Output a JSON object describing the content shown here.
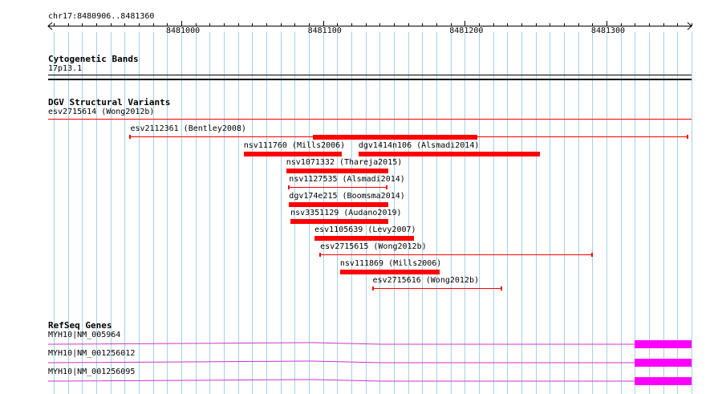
{
  "ruler": {
    "range_label": "chr17:8480906..8481360",
    "ticks": [
      8481000,
      8481100,
      8481200,
      8481300
    ]
  },
  "tracks": {
    "cytoband": {
      "title": "Cytogenetic Bands",
      "band_label": "17p13.1"
    },
    "dgv": {
      "title": "DGV Structural Variants",
      "top_label": "esv2715614 (Wong2012b)",
      "features": [
        {
          "label": "esv2112361 (Bentley2008)",
          "start": 8480964,
          "end": 8481357,
          "style": "line"
        },
        {
          "label": "",
          "start": 8481093,
          "end": 8481209,
          "style": "bar"
        },
        {
          "label": "nsv111760 (Mills2006)",
          "start": 8481044,
          "end": 8481113,
          "style": "bar"
        },
        {
          "label": "dgv1414n106 (Alsmadi2014)",
          "start": 8481125,
          "end": 8481253,
          "style": "bar"
        },
        {
          "label": "nsv1071332 (Thareja2015)",
          "start": 8481074,
          "end": 8481146,
          "style": "bar"
        },
        {
          "label": "nsv1127535 (Alsmadi2014)",
          "start": 8481076,
          "end": 8481145,
          "style": "line"
        },
        {
          "label": "dgv174e215 (Boomsma2014)",
          "start": 8481076,
          "end": 8481146,
          "style": "bar"
        },
        {
          "label": "nsv3351129 (Audano2019)",
          "start": 8481077,
          "end": 8481146,
          "style": "bar"
        },
        {
          "label": "esv1105639 (Levy2007)",
          "start": 8481094,
          "end": 8481164,
          "style": "bar"
        },
        {
          "label": "esv2715615 (Wong2012b)",
          "start": 8481098,
          "end": 8481290,
          "style": "line"
        },
        {
          "label": "nsv111869 (Mills2006)",
          "start": 8481112,
          "end": 8481182,
          "style": "bar"
        },
        {
          "label": "esv2715616 (Wong2012b)",
          "start": 8481135,
          "end": 8481226,
          "style": "line"
        }
      ]
    },
    "refseq": {
      "title": "RefSeq Genes",
      "genes": [
        {
          "label": "MYH10|NM_005964"
        },
        {
          "label": "MYH10|NM_001256012"
        },
        {
          "label": "MYH10|NM_001256095"
        }
      ]
    }
  },
  "colors": {
    "grid": "#a8d0e8",
    "variant": "#ff0000",
    "gene_line": "#cc33cc",
    "gene_exon": "#ff00ff"
  }
}
